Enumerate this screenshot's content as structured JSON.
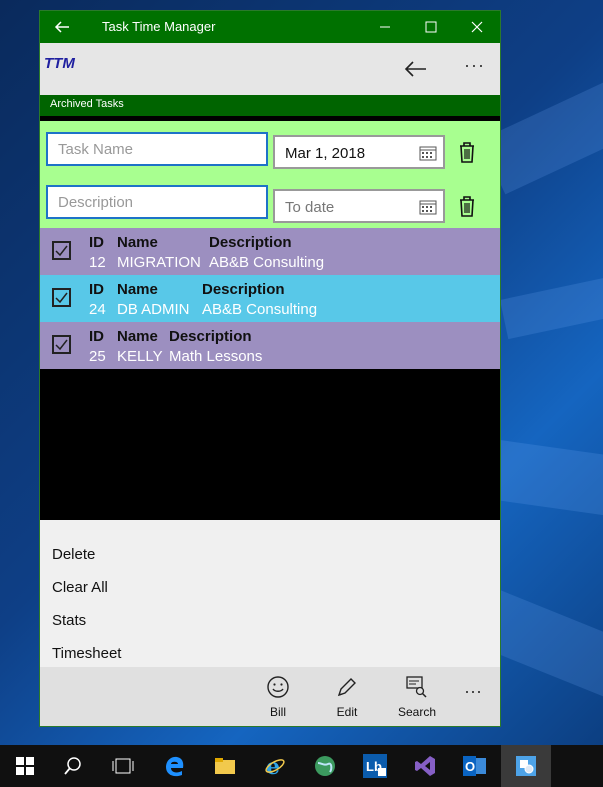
{
  "window": {
    "title": "Task Time Manager",
    "titlebar_color": "#007100"
  },
  "appbar": {
    "logo": "TTM",
    "section_title": "Archived Tasks"
  },
  "filter": {
    "task_name_placeholder": "Task Name",
    "description_placeholder": "Description",
    "from_date": "Mar 1, 2018",
    "to_date_placeholder": "To date",
    "background": "#a8ff90"
  },
  "tasks": [
    {
      "checked": true,
      "h_id": "ID",
      "h_name": "Name",
      "h_desc": "Description",
      "id": "12",
      "name": "MIGRATION",
      "description": "AB&B Consulting",
      "color": "#9c8fc0"
    },
    {
      "checked": true,
      "h_id": "ID",
      "h_name": "Name",
      "h_desc": "Description",
      "id": "24",
      "name": "DB ADMIN",
      "description": "AB&B Consulting",
      "color": "#58c8e8"
    },
    {
      "checked": true,
      "h_id": "ID",
      "h_name": "Name",
      "h_desc": "Description",
      "id": "25",
      "name": "KELLY",
      "description": "Math Lessons",
      "color": "#9c8fc0"
    }
  ],
  "menu": {
    "items": [
      "Delete",
      "Clear All",
      "Stats",
      "Timesheet"
    ]
  },
  "commandbar": {
    "bill": "Bill",
    "edit": "Edit",
    "search": "Search",
    "more": "···"
  },
  "icons": {
    "back": "back-arrow-icon",
    "minimize": "minimize-icon",
    "maximize": "maximize-icon",
    "close": "close-icon",
    "calendar": "calendar-icon",
    "trash": "trash-icon"
  }
}
